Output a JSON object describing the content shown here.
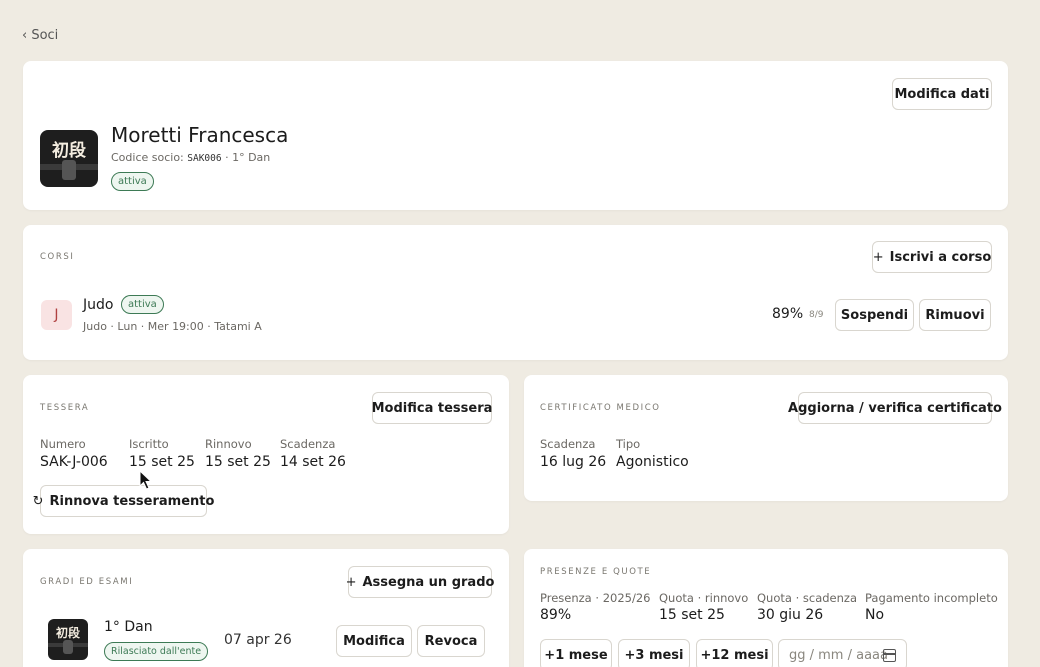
{
  "nav": {
    "back_label": "‹ Soci"
  },
  "profile": {
    "name": "Moretti Francesca",
    "code_label": "Codice socio:",
    "code": "SAK006",
    "rank": "· 1° Dan",
    "status": "attiva",
    "edit_button": "Modifica dati",
    "emblem_text": "初段"
  },
  "courses": {
    "section_title": "CORSI",
    "enroll_button": "Iscrivi a corso",
    "enroll_icon": "plus-icon",
    "items": [
      {
        "initial": "J",
        "name": "Judo",
        "status": "attiva",
        "details": "Judo · Lun · Mer 19:00 · Tatami A",
        "attendance_pct": "89%",
        "attendance_count": "8/9",
        "suspend_button": "Sospendi",
        "remove_button": "Rimuovi"
      }
    ]
  },
  "card_membership": {
    "section_title": "TESSERA",
    "edit_button": "Modifica tessera",
    "fields": [
      {
        "label": "Numero",
        "value": "SAK-J-006"
      },
      {
        "label": "Iscritto",
        "value": "15 set 25"
      },
      {
        "label": "Rinnovo",
        "value": "15 set 25"
      },
      {
        "label": "Scadenza",
        "value": "14 set 26"
      }
    ],
    "renew_button": "Rinnova tesseramento",
    "renew_icon": "refresh-icon"
  },
  "medical": {
    "section_title": "CERTIFICATO MEDICO",
    "update_button": "Aggiorna / verifica certificato",
    "fields": [
      {
        "label": "Scadenza",
        "value": "16 lug 26"
      },
      {
        "label": "Tipo",
        "value": "Agonistico"
      }
    ]
  },
  "grades": {
    "section_title": "GRADI ED ESAMI",
    "assign_button": "Assegna un grado",
    "items": [
      {
        "emblem_text": "初段",
        "grade": "1° Dan",
        "issuer_badge": "Rilasciato dall'ente",
        "date": "07 apr 26",
        "edit_button": "Modifica",
        "revoke_button": "Revoca"
      }
    ]
  },
  "attendance_fees": {
    "section_title": "PRESENZE E QUOTE",
    "fields": [
      {
        "label": "Presenza · 2025/26",
        "value": "89%"
      },
      {
        "label": "Quota · rinnovo",
        "value": "15 set 25"
      },
      {
        "label": "Quota · scadenza",
        "value": "30 giu 26"
      },
      {
        "label": "Pagamento incompleto",
        "value": "No"
      }
    ],
    "extend_buttons": [
      "+1 mese",
      "+3 mesi",
      "+12 mesi"
    ],
    "date_placeholder": "gg / mm / aaaa",
    "calendar_icon": "calendar-icon"
  },
  "colors": {
    "background": "#efebe2",
    "badge_green": "#3d7a55",
    "course_initial_bg": "#f9e3e3",
    "course_initial_fg": "#b04040"
  }
}
